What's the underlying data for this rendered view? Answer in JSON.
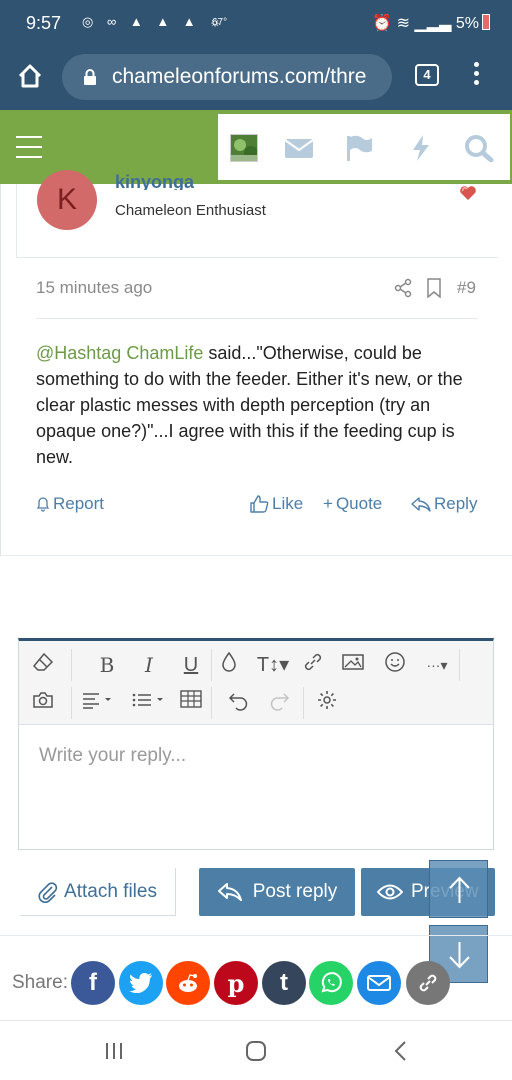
{
  "status_bar": {
    "time": "9:57",
    "temperature": "67°",
    "battery": "5%"
  },
  "browser": {
    "url": "chameleonforums.com/thre",
    "tab_count": "4"
  },
  "post": {
    "avatar_letter": "K",
    "username": "kinyonga",
    "user_title": "Chameleon Enthusiast",
    "timestamp": "15 minutes ago",
    "post_number": "#9",
    "mention": "@Hashtag ChamLife",
    "body": " said...\"Otherwise, could be something to do with the feeder. Either it's new, or the clear plastic messes with depth perception (try an opaque one?)\"...I agree with this if the feeding cup is new.",
    "actions": {
      "report": "Report",
      "like": "Like",
      "quote": "Quote",
      "reply": "Reply"
    }
  },
  "editor": {
    "placeholder": "Write your reply..."
  },
  "buttons": {
    "attach": "Attach files",
    "post_reply": "Post reply",
    "preview": "Preview"
  },
  "share": {
    "label": "Share:",
    "networks": [
      {
        "name": "facebook",
        "glyph": "f",
        "color": "#3b5998"
      },
      {
        "name": "twitter",
        "glyph": "t",
        "color": "#1da1f2"
      },
      {
        "name": "reddit",
        "glyph": "r",
        "color": "#ff4500"
      },
      {
        "name": "pinterest",
        "glyph": "p",
        "color": "#bd081c"
      },
      {
        "name": "tumblr",
        "glyph": "t",
        "color": "#35465c"
      },
      {
        "name": "whatsapp",
        "glyph": "w",
        "color": "#25d366"
      },
      {
        "name": "email",
        "glyph": "e",
        "color": "#1e88e5"
      },
      {
        "name": "link",
        "glyph": "l",
        "color": "#777777"
      }
    ]
  },
  "colors": {
    "header": "#2f5370",
    "forum_nav": "#7aa846",
    "accent": "#4d7fa6"
  }
}
